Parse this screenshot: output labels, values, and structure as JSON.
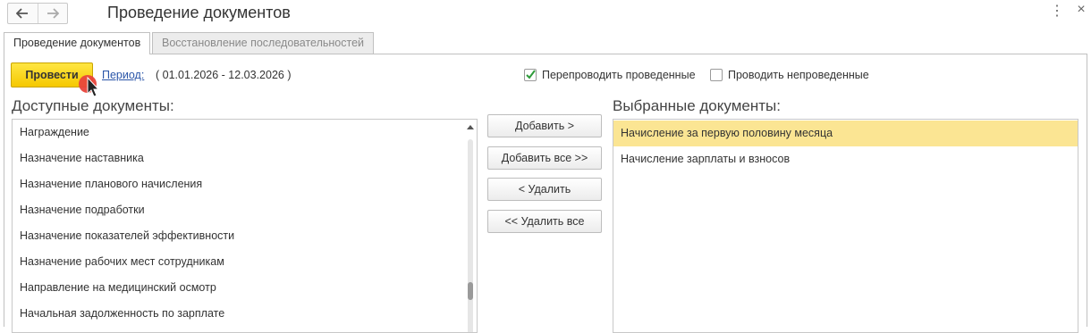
{
  "window": {
    "title": "Проведение документов",
    "icons": {
      "back": "arrow-left-icon",
      "forward": "arrow-right-icon",
      "more": "more-vertical-icon",
      "close": "close-icon"
    },
    "more_glyph": "⋮",
    "close_glyph": "×"
  },
  "tabs": [
    {
      "label": "Проведение документов",
      "active": true
    },
    {
      "label": "Восстановление последовательностей",
      "active": false
    }
  ],
  "toolbar": {
    "post_button": "Провести",
    "period_link": "Период:",
    "period_value": "( 01.01.2026 - 12.03.2026 )",
    "repost_label": "Перепроводить проведенные",
    "repost_checked": true,
    "unposted_label": "Проводить непроведенные",
    "unposted_checked": false
  },
  "available": {
    "title": "Доступные документы:",
    "items": [
      "Награждение",
      "Назначение наставника",
      "Назначение планового начисления",
      "Назначение подработки",
      "Назначение показателей эффективности",
      "Назначение рабочих мест сотрудникам",
      "Направление на медицинский осмотр",
      "Начальная задолженность по зарплате"
    ]
  },
  "actions": {
    "add": "Добавить >",
    "add_all": "Добавить все >>",
    "remove": "< Удалить",
    "remove_all": "<< Удалить все"
  },
  "selected": {
    "title": "Выбранные документы:",
    "items": [
      "Начисление за первую половину месяца",
      "Начисление зарплаты и взносов"
    ],
    "highlighted_index": 0
  },
  "colors": {
    "primary_button": "#f5c800",
    "selection": "#fbe593",
    "link": "#2a55a8",
    "checkmark": "#2e9b3a"
  }
}
